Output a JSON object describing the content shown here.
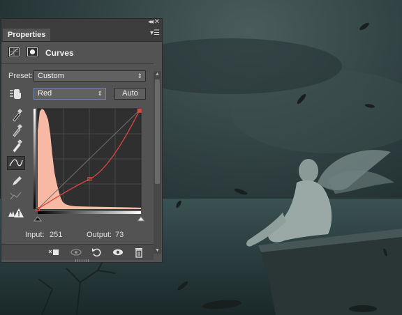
{
  "panel": {
    "tab_label": "Properties",
    "collapse_glyph": "◂◂",
    "close_glyph": "✕",
    "menu_glyph": "▾☰",
    "title": "Curves",
    "preset_label": "Preset:",
    "preset_value": "Custom",
    "channel_value": "Red",
    "auto_label": "Auto",
    "input_label": "Input:",
    "input_value": "251",
    "output_label": "Output:",
    "output_value": "73"
  },
  "curve": {
    "points": [
      [
        0,
        0
      ],
      [
        128,
        76
      ],
      [
        251,
        250
      ]
    ],
    "selected_point": [
      251,
      250
    ]
  },
  "colors": {
    "panel_bg": "#535353",
    "curve_red": "#d9473f",
    "histogram": "#f7b9a3"
  },
  "icons": [
    "adjustment-curves-icon",
    "layer-mask-icon",
    "target-adjust-hand-icon",
    "black-eyedropper-icon",
    "gray-eyedropper-icon",
    "white-eyedropper-icon",
    "curve-edit-icon",
    "pencil-draw-icon",
    "smooth-curve-icon",
    "clipping-warning-icon",
    "clip-to-layer-icon",
    "view-previous-state-icon",
    "reset-icon",
    "visibility-eye-icon",
    "trash-icon"
  ]
}
